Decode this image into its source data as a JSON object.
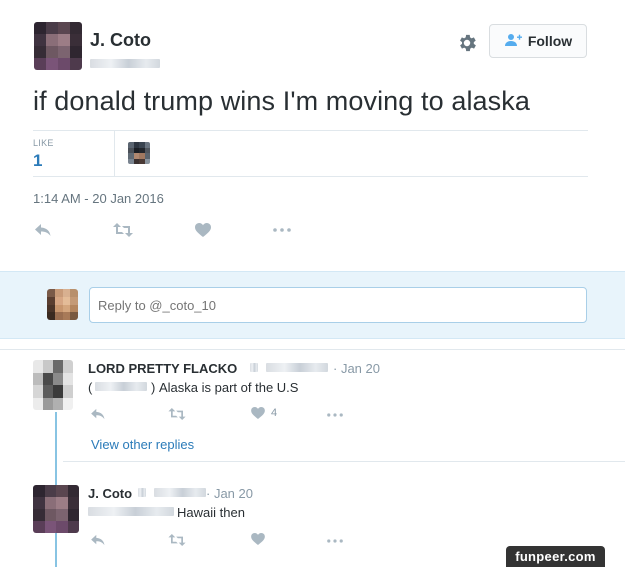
{
  "tweet": {
    "author_name": "J. Coto",
    "follow_label": "Follow",
    "text": "if donald trump wins I'm moving to alaska",
    "like_label": "LIKE",
    "like_count": "1",
    "timestamp": "1:14 AM - 20 Jan 2016"
  },
  "reply_box": {
    "placeholder": "Reply to @_coto_10"
  },
  "replies": [
    {
      "author_name": "LORD PRETTY FLACKO",
      "time": "· Jan 20",
      "mention_open": "(",
      "mention_close": ")",
      "text": "Alaska is part of the U.S",
      "like_count": "4"
    },
    {
      "author_name": "J. Coto",
      "time": "· Jan 20",
      "text": "Hawaii then"
    }
  ],
  "view_other_replies": "View other replies",
  "watermark": "funpeer.com",
  "icons": [
    "gear-icon",
    "add-user-icon",
    "reply-icon",
    "retweet-icon",
    "heart-icon",
    "more-icon"
  ],
  "colors": {
    "link": "#2b7bb9",
    "muted": "#8899a6",
    "icon": "#aab8c2",
    "reply_bg": "#e8f4fb",
    "thread_line": "#88c4e3"
  }
}
